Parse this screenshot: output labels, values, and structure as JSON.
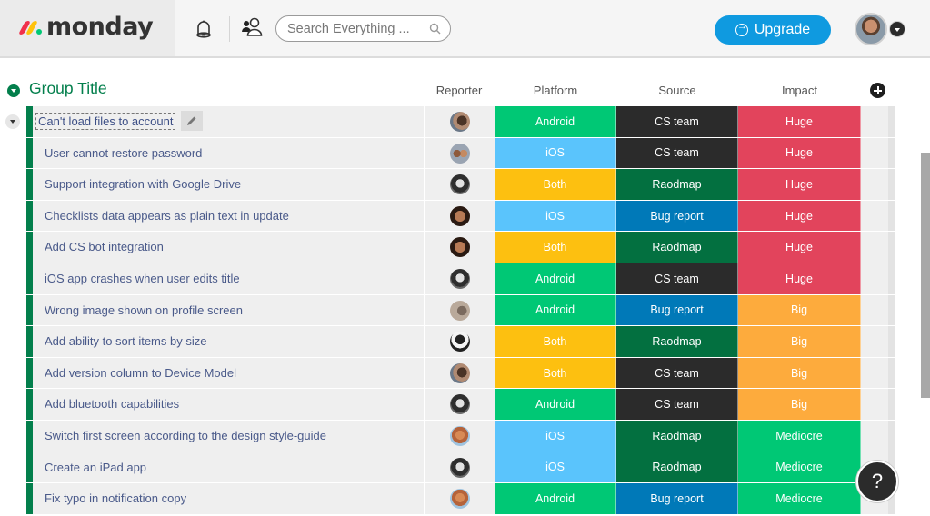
{
  "app": {
    "brand": "monday",
    "brand_colors": {
      "red": "#f1304b",
      "yellow": "#fec20a",
      "green": "#00c875"
    }
  },
  "topbar": {
    "search_placeholder": "Search Everything ...",
    "upgrade_label": "Upgrade",
    "upgrade_color": "#0f9ae0",
    "icons": [
      "bell-icon",
      "people-icon",
      "search-icon",
      "arrow-circle-icon",
      "avatar",
      "caret-down-icon"
    ]
  },
  "group": {
    "title": "Group Title",
    "color": "#037f4c",
    "columns": {
      "reporter": "Reporter",
      "platform": "Platform",
      "source": "Source",
      "impact": "Impact"
    }
  },
  "status_colors": {
    "Android": "#00c875",
    "iOS": "#579bfc",
    "Both": "#fdc010",
    "CS team": "#2b2b2b",
    "Raodmap": "#037040",
    "Bug report": "#0079b8",
    "Huge": "#e2445c",
    "Big": "#fdab3d",
    "Mediocre": "#00c875"
  },
  "rows": [
    {
      "name": "Can't load files to account",
      "editing": true,
      "reporter": "reporter-avatar-a",
      "platform": "Android",
      "source": "CS team",
      "impact": "Huge"
    },
    {
      "name": "User cannot restore password",
      "editing": false,
      "reporter": "reporter-avatar-b",
      "platform": "iOS",
      "source": "CS team",
      "impact": "Huge"
    },
    {
      "name": "Support integration with Google Drive",
      "editing": false,
      "reporter": "reporter-avatar-c",
      "platform": "Both",
      "source": "Raodmap",
      "impact": "Huge"
    },
    {
      "name": "Checklists data appears as plain text in update",
      "editing": false,
      "reporter": "reporter-avatar-d",
      "platform": "iOS",
      "source": "Bug report",
      "impact": "Huge"
    },
    {
      "name": "Add CS bot integration",
      "editing": false,
      "reporter": "reporter-avatar-d",
      "platform": "Both",
      "source": "Raodmap",
      "impact": "Huge"
    },
    {
      "name": "iOS app crashes when user edits title",
      "editing": false,
      "reporter": "reporter-avatar-c",
      "platform": "Android",
      "source": "CS team",
      "impact": "Huge"
    },
    {
      "name": "Wrong image shown on profile screen",
      "editing": false,
      "reporter": "reporter-avatar-e",
      "platform": "Android",
      "source": "Bug report",
      "impact": "Big"
    },
    {
      "name": "Add ability to sort items by size",
      "editing": false,
      "reporter": "reporter-avatar-f",
      "platform": "Both",
      "source": "Raodmap",
      "impact": "Big"
    },
    {
      "name": "Add version column to Device Model",
      "editing": false,
      "reporter": "reporter-avatar-a",
      "platform": "Both",
      "source": "CS team",
      "impact": "Big"
    },
    {
      "name": "Add bluetooth capabilities",
      "editing": false,
      "reporter": "reporter-avatar-c",
      "platform": "Android",
      "source": "CS team",
      "impact": "Big"
    },
    {
      "name": "Switch first screen according to the design style-guide",
      "editing": false,
      "reporter": "reporter-avatar-g",
      "platform": "iOS",
      "source": "Raodmap",
      "impact": "Mediocre"
    },
    {
      "name": "Create an iPad app",
      "editing": false,
      "reporter": "reporter-avatar-c",
      "platform": "iOS",
      "source": "Raodmap",
      "impact": "Mediocre"
    },
    {
      "name": "Fix typo in notification copy",
      "editing": false,
      "reporter": "reporter-avatar-g",
      "platform": "Android",
      "source": "Bug report",
      "impact": "Mediocre"
    }
  ],
  "help_label": "?"
}
